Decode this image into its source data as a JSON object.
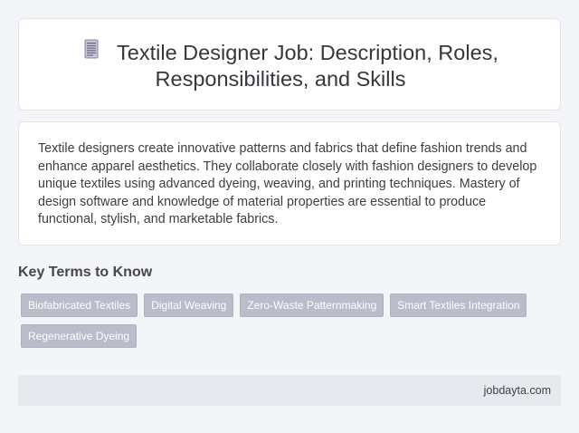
{
  "header": {
    "icon": "document-icon",
    "title_line1": "Textile Designer Job: Description, Roles,",
    "title_line2": "Responsibilities, and Skills"
  },
  "description": "Textile designers create innovative patterns and fabrics that define fashion trends and enhance apparel aesthetics. They collaborate closely with fashion designers to develop unique textiles using advanced dyeing, weaving, and printing techniques. Mastery of design software and knowledge of material properties are essential to produce functional, stylish, and marketable fabrics.",
  "key_terms": {
    "heading": "Key Terms to Know",
    "items": [
      "Biofabricated Textiles",
      "Digital Weaving",
      "Zero-Waste Patternmaking",
      "Smart Textiles Integration",
      "Regenerative Dyeing"
    ]
  },
  "footer": {
    "site": "jobdayta.com"
  }
}
